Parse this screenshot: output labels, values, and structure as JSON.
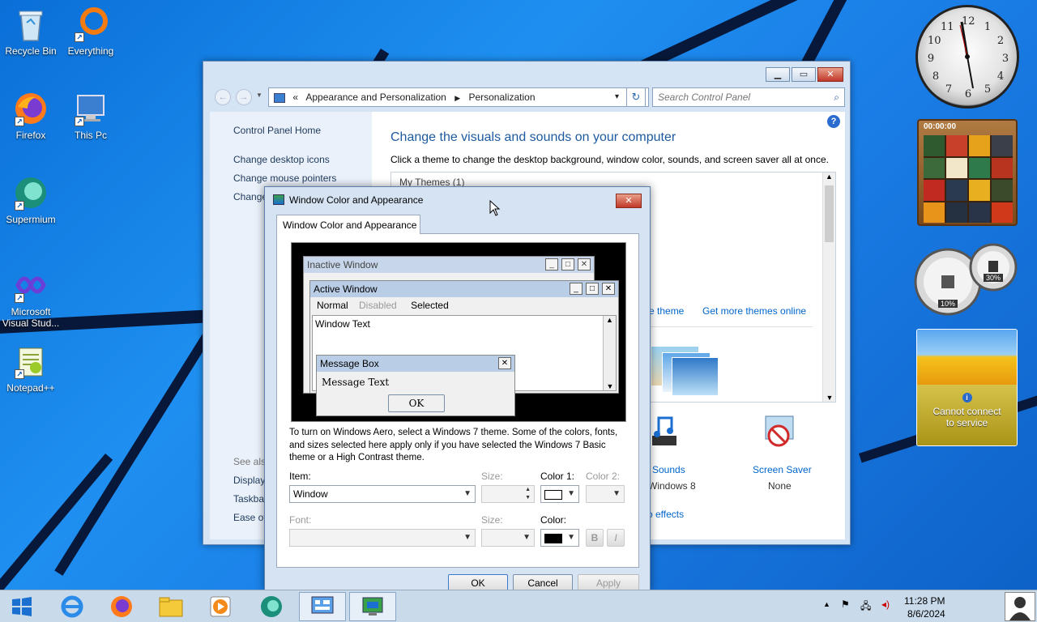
{
  "desktop": {
    "icons": [
      {
        "label": "Recycle Bin"
      },
      {
        "label": "Everything"
      },
      {
        "label": "Firefox"
      },
      {
        "label": "This Pc"
      },
      {
        "label": "Supermium"
      },
      {
        "label": "Microsoft Visual Stud..."
      },
      {
        "label": "Notepad++"
      }
    ]
  },
  "gadgets": {
    "puzzle_timer": "00:00:00",
    "meter_cpu": "10%",
    "meter_mem": "30%",
    "weather_message": "Cannot connect to service"
  },
  "control_panel": {
    "address": {
      "sep": "«",
      "crumb1": "Appearance and Personalization",
      "crumb2": "Personalization"
    },
    "search_placeholder": "Search Control Panel",
    "nav": {
      "home": "Control Panel Home",
      "link1": "Change desktop icons",
      "link2": "Change mouse pointers",
      "link3": "Change",
      "see_also": "See also",
      "display": "Display",
      "taskbar": "Taskbar",
      "ease": "Ease of"
    },
    "heading": "Change the visuals and sounds on your computer",
    "description": "Click a theme to change the desktop background, window color, sounds, and screen saver all at once.",
    "my_themes": "My Themes (1)",
    "theme_link": "e theme",
    "get_more": "Get more themes online",
    "sounds_label": "Sounds",
    "sounds_value": "Windows 8",
    "screensaver_label": "Screen Saver",
    "screensaver_value": "None",
    "effects_link": "o effects"
  },
  "dialog": {
    "title": "Window Color and Appearance",
    "tab": "Window Color and Appearance",
    "preview": {
      "inactive": "Inactive Window",
      "active": "Active Window",
      "menu_normal": "Normal",
      "menu_disabled": "Disabled",
      "menu_selected": "Selected",
      "window_text": "Window Text",
      "msgbox_title": "Message Box",
      "msgbox_text": "Message Text",
      "msgbox_ok": "OK"
    },
    "info": "To turn on Windows Aero, select a Windows 7 theme.  Some of the colors, fonts, and sizes selected here apply only if you have selected the Windows 7 Basic theme or a High Contrast theme.",
    "item_label": "Item:",
    "item_value": "Window",
    "size_label": "Size:",
    "color1_label": "Color 1:",
    "color2_label": "Color 2:",
    "font_label": "Font:",
    "size2_label": "Size:",
    "color_label": "Color:",
    "bold": "B",
    "italic": "I",
    "ok": "OK",
    "cancel": "Cancel",
    "apply": "Apply"
  },
  "taskbar": {
    "time": "11:28 PM",
    "date": "8/6/2024"
  },
  "colors": {
    "accent": "#0066cc",
    "desktop": "#1a7de6"
  }
}
